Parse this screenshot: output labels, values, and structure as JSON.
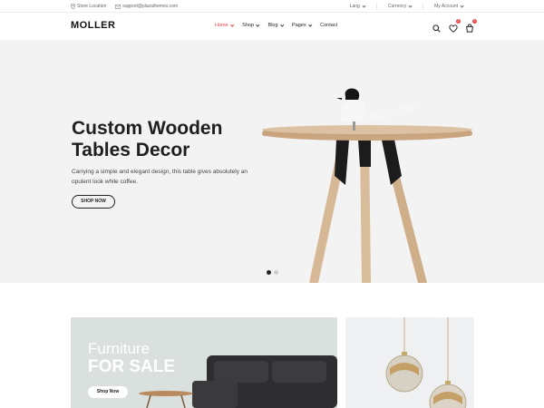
{
  "topbar": {
    "store_location": "Store Location",
    "email": "support@plazathemes.com",
    "lang": "Lang",
    "currency": "Currency",
    "account": "My Account"
  },
  "header": {
    "logo": "MOLLER",
    "nav": [
      {
        "label": "Home",
        "active": true,
        "has_dropdown": true
      },
      {
        "label": "Shop",
        "active": false,
        "has_dropdown": true
      },
      {
        "label": "Blog",
        "active": false,
        "has_dropdown": true
      },
      {
        "label": "Pages",
        "active": false,
        "has_dropdown": true
      },
      {
        "label": "Contact",
        "active": false,
        "has_dropdown": false
      }
    ],
    "wishlist_count": "0",
    "cart_count": "0",
    "icons": [
      "search-icon",
      "heart-icon",
      "cart-icon"
    ]
  },
  "hero": {
    "title_line1": "Custom Wooden",
    "title_line2": "Tables Decor",
    "description": "Carrying a simple and elegant design, this table gives absolutely an opulent look while coffee.",
    "button": "SHOP NOW",
    "slides": 2,
    "active_slide": 1
  },
  "banners": {
    "furniture_line1": "Furniture",
    "furniture_line2": "FOR SALE",
    "furniture_button": "Shop Now"
  },
  "colors": {
    "accent": "#e84545",
    "hero_bg": "#f3f3f3",
    "banner_bg": "#d9e0dd"
  }
}
